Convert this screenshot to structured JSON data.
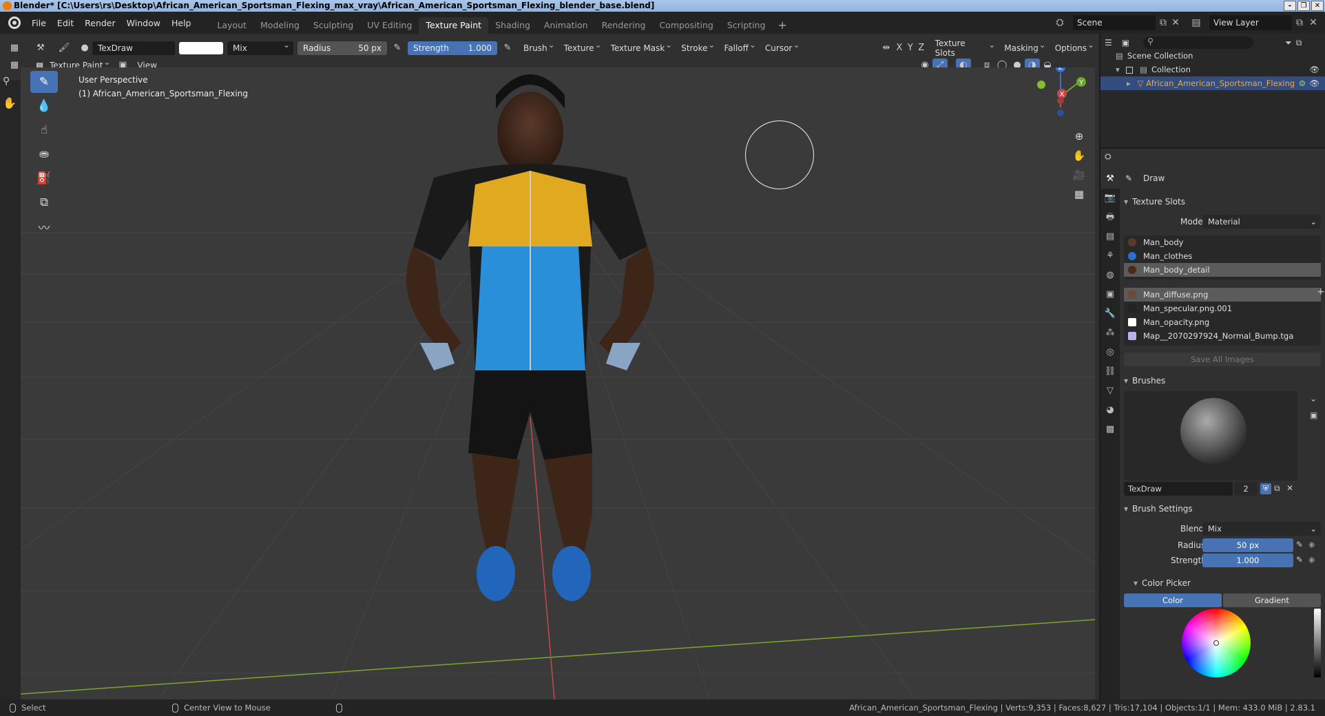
{
  "window": {
    "title": "Blender* [C:\\Users\\rs\\Desktop\\African_American_Sportsman_Flexing_max_vray\\African_American_Sportsman_Flexing_blender_base.blend]"
  },
  "menu": [
    "File",
    "Edit",
    "Render",
    "Window",
    "Help"
  ],
  "workspaces": {
    "tabs": [
      "Layout",
      "Modeling",
      "Sculpting",
      "UV Editing",
      "Texture Paint",
      "Shading",
      "Animation",
      "Rendering",
      "Compositing",
      "Scripting"
    ],
    "active": "Texture Paint",
    "add": "+"
  },
  "scene": {
    "name": "Scene",
    "view_layer": "View Layer"
  },
  "toolheader": {
    "brush_name": "TexDraw",
    "blend": "Mix",
    "radius_label": "Radius",
    "radius_value": "50 px",
    "strength_label": "Strength",
    "strength_value": "1.000",
    "menus": [
      "Brush",
      "Texture",
      "Texture Mask",
      "Stroke",
      "Falloff",
      "Cursor"
    ],
    "axes": [
      "X",
      "Y",
      "Z"
    ],
    "right_menus": [
      "Texture Slots",
      "Masking",
      "Options"
    ],
    "mode": "Texture Paint",
    "view": "View"
  },
  "viewport": {
    "perspective": "User Perspective",
    "object": "(1) African_American_Sportsman_Flexing",
    "gizmo": {
      "z": "Z",
      "y": "Y",
      "x": "X"
    }
  },
  "outliner": {
    "root": "Scene Collection",
    "collection": "Collection",
    "object": "African_American_Sportsman_Flexing"
  },
  "properties": {
    "tool": "Draw",
    "texture_slots": {
      "title": "Texture Slots",
      "mode_label": "Mode",
      "mode_value": "Material",
      "materials": [
        "Man_body",
        "Man_clothes",
        "Man_body_detail"
      ],
      "selected_material": "Man_body_detail",
      "images": [
        "Man_diffuse.png",
        "Man_specular.png.001",
        "Man_opacity.png",
        "Map__2070297924_Normal_Bump.tga"
      ],
      "selected_image": "Man_diffuse.png",
      "save_all": "Save All Images"
    },
    "brushes": {
      "title": "Brushes",
      "name": "TexDraw",
      "users": "2"
    },
    "brush_settings": {
      "title": "Brush Settings",
      "blend_label": "Blend",
      "blend_value": "Mix",
      "radius_label": "Radius",
      "radius_value": "50 px",
      "strength_label": "Strength",
      "strength_value": "1.000"
    },
    "color_picker": {
      "title": "Color Picker",
      "tabs": [
        "Color",
        "Gradient"
      ],
      "active": "Color"
    }
  },
  "statusbar": {
    "select": "Select",
    "center": "Center View to Mouse",
    "stats": "African_American_Sportsman_Flexing | Verts:9,353 | Faces:8,627 | Tris:17,104 | Objects:1/1 | Mem: 433.0 MiB | 2.83.1"
  },
  "colors": {
    "accent": "#4772b3",
    "header": "#232323",
    "panel": "#303030",
    "viewport": "#3a3a3a"
  }
}
